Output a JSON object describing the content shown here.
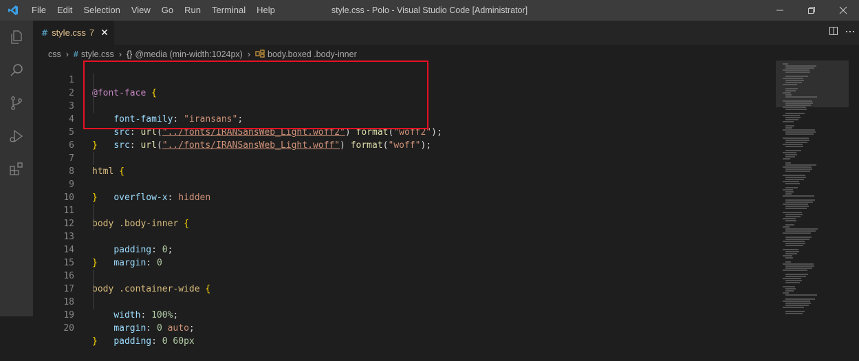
{
  "window": {
    "title": "style.css - Polo - Visual Studio Code [Administrator]",
    "menu": [
      "File",
      "Edit",
      "Selection",
      "View",
      "Go",
      "Run",
      "Terminal",
      "Help"
    ]
  },
  "tab": {
    "icon": "#",
    "name": "style.css",
    "problems": "7",
    "close": "✕"
  },
  "breadcrumb": {
    "folder": "css",
    "file_icon": "#",
    "file": "style.css",
    "media_icon": "{}",
    "media": "@media (min-width:1024px)",
    "selector": "body.boxed .body-inner"
  },
  "editor": {
    "lines": [
      {
        "n": "1"
      },
      {
        "n": "2"
      },
      {
        "n": "3"
      },
      {
        "n": "4"
      },
      {
        "n": "5"
      },
      {
        "n": "6"
      },
      {
        "n": "7"
      },
      {
        "n": "8"
      },
      {
        "n": "9"
      },
      {
        "n": "10"
      },
      {
        "n": "11"
      },
      {
        "n": "12"
      },
      {
        "n": "13"
      },
      {
        "n": "14"
      },
      {
        "n": "15"
      },
      {
        "n": "16"
      },
      {
        "n": "17"
      },
      {
        "n": "18"
      },
      {
        "n": "19"
      },
      {
        "n": "20"
      }
    ],
    "t": {
      "fontface": "@font-face",
      "ob": "{",
      "cb": "}",
      "ff_prop": "font-family",
      "ff_val": "\"iransans\"",
      "src": "src",
      "url": "url",
      "woff2_path": "\"../fonts/IRANSansWeb_Light.woff2\"",
      "woff_path": "\"../fonts/IRANSansWeb_Light.woff\"",
      "format": "format",
      "woff2": "\"woff2\"",
      "woff": "\"woff\"",
      "html": "html",
      "overflow": "overflow-x",
      "hidden": "hidden",
      "body": "body",
      "bodyinner": ".body-inner",
      "containerwide": ".container-wide",
      "padding": "padding",
      "margin": "margin",
      "zero": "0",
      "width": "width",
      "hundred": "100%",
      "auto": "auto",
      "sixty": "60px"
    }
  },
  "colors": {
    "highlight_box": "#e81123",
    "accent": "#007acc"
  }
}
